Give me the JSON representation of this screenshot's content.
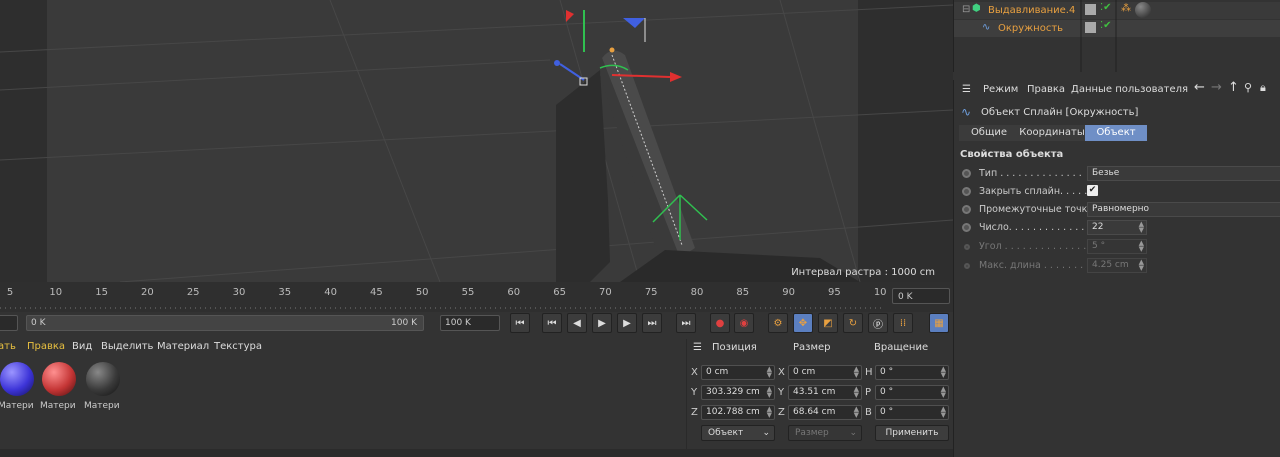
{
  "viewport": {
    "raster_label": "Интервал растра : 1000 cm"
  },
  "timeline": {
    "ticks": [
      "5",
      "10",
      "15",
      "20",
      "25",
      "30",
      "35",
      "40",
      "45",
      "50",
      "55",
      "60",
      "65",
      "70",
      "75",
      "80",
      "85",
      "90",
      "95",
      "10"
    ],
    "current_frame": "0 K"
  },
  "transport": {
    "range_start": "0 K",
    "range_end": "100 K",
    "max_frame": "100 K"
  },
  "materials_menu": {
    "items": [
      "ать",
      "Правка",
      "Вид",
      "Выделить",
      "Материал",
      "Текстура"
    ]
  },
  "materials": [
    {
      "label": "Матери",
      "color": "#3d34d8"
    },
    {
      "label": "Матери",
      "color": "#c43535"
    },
    {
      "label": "Матери",
      "color": "#3a3a3a"
    }
  ],
  "coordinates": {
    "headers": [
      "Позиция",
      "Размер",
      "Вращение"
    ],
    "rows": [
      {
        "axis": "X",
        "position": "0 cm",
        "size_axis": "X",
        "size": "0 cm",
        "rot_axis": "H",
        "rotation": "0 °"
      },
      {
        "axis": "Y",
        "position": "303.329 cm",
        "size_axis": "Y",
        "size": "43.51 cm",
        "rot_axis": "P",
        "rotation": "0 °"
      },
      {
        "axis": "Z",
        "position": "102.788 cm",
        "size_axis": "Z",
        "size": "68.64 cm",
        "rot_axis": "B",
        "rotation": "0 °"
      }
    ],
    "mode": "Объект",
    "size_mode": "Размер",
    "apply": "Применить"
  },
  "object_manager": {
    "items": [
      {
        "name": "Выдавливание.4",
        "color": "#e8a040"
      },
      {
        "name": "Окружность",
        "color": "#e8a040"
      }
    ]
  },
  "attributes": {
    "menu": [
      "Режим",
      "Правка",
      "Данные пользователя"
    ],
    "title": "Объект Сплайн [Окружность]",
    "tabs": [
      "Общие",
      "Координаты",
      "Объект"
    ],
    "active_tab": "Объект",
    "section": "Свойства объекта",
    "props": [
      {
        "label": "Тип . . . . . . . . . . . . . .",
        "value": "Безье"
      },
      {
        "label": "Закрыть сплайн. . . . .",
        "value": ""
      },
      {
        "label": "Промежуточные точки",
        "value": "Равномерно"
      },
      {
        "label": "Число. . . . . . . . . . . . .",
        "value": "22"
      },
      {
        "label": "Угол . . . . . . . . . . . . . .",
        "value": "5 °"
      },
      {
        "label": "Макс. длина . . . . . . . .",
        "value": "4.25 cm"
      }
    ]
  }
}
